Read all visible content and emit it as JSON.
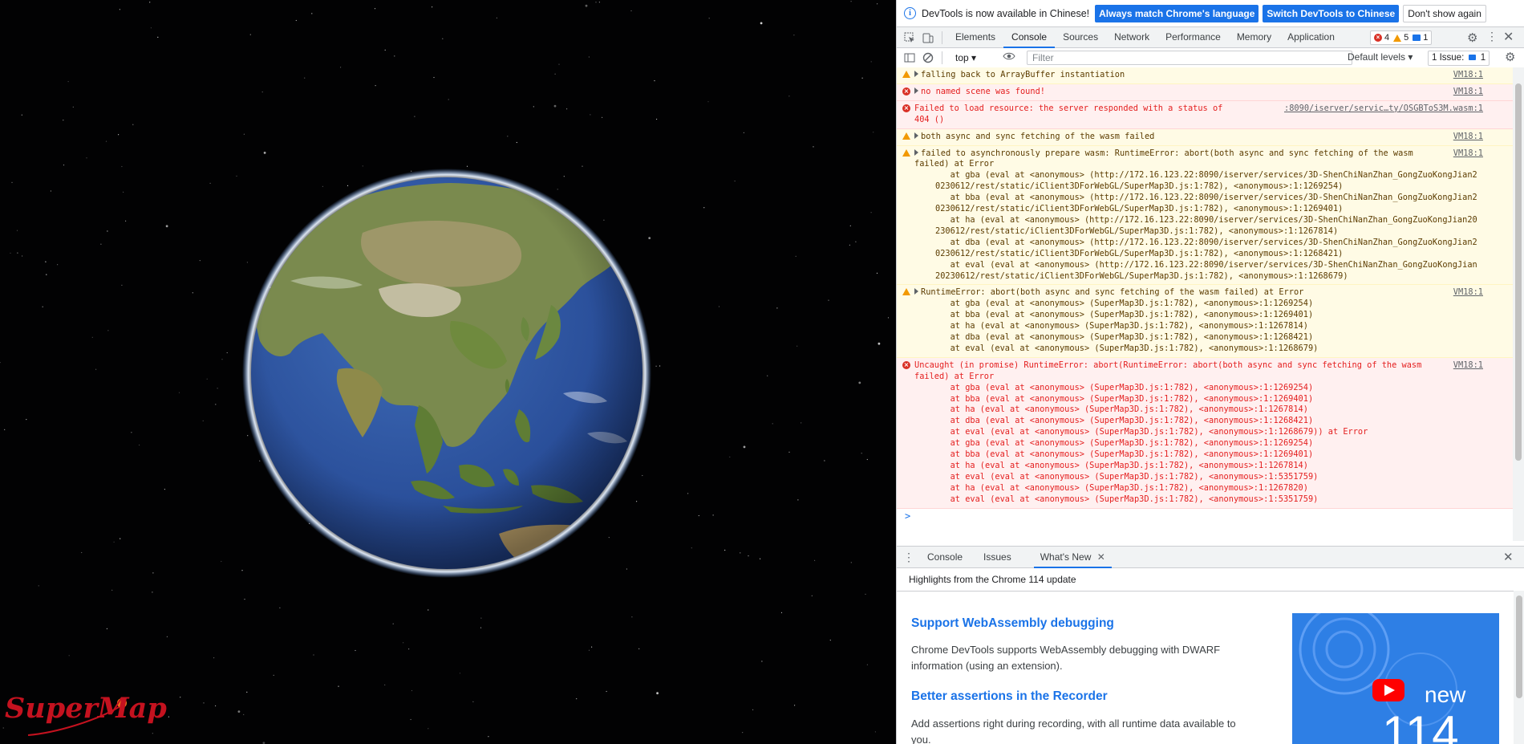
{
  "viewport": {
    "logo_text": "SuperMap",
    "colors": {
      "background": "#020203",
      "logo": "#c4121f",
      "ocean": "#2a4f9a",
      "land": "#7a8a4e"
    }
  },
  "devtools": {
    "infobar": {
      "text": "DevTools is now available in Chinese!",
      "btn_match": "Always match Chrome's language",
      "btn_switch": "Switch DevTools to Chinese",
      "btn_dont": "Don't show again"
    },
    "tabs": [
      "Elements",
      "Console",
      "Sources",
      "Network",
      "Performance",
      "Memory",
      "Application"
    ],
    "active_tab": "Console",
    "counts": {
      "errors": "4",
      "warnings": "5",
      "messages": "1"
    },
    "toolbar": {
      "context": "top",
      "filter_placeholder": "Filter",
      "levels": "Default levels",
      "issues_label": "1 Issue:",
      "issues_count": "1"
    },
    "console": {
      "rows": [
        {
          "level": "warn",
          "expandable": true,
          "text": "falling back to ArrayBuffer instantiation",
          "source": "VM18:1"
        },
        {
          "level": "error",
          "expandable": true,
          "text": "no named scene was found!",
          "source": "VM18:1"
        },
        {
          "level": "error",
          "expandable": false,
          "text": "Failed to load resource: the server responded with a status of\n404 ()",
          "source": ":8090/iserver/servic…ty/OSGBToS3M.wasm:1"
        },
        {
          "level": "warn",
          "expandable": true,
          "text": "both async and sync fetching of the wasm failed",
          "source": "VM18:1"
        },
        {
          "level": "warn",
          "expandable": true,
          "text": "failed to asynchronously prepare wasm: RuntimeError: abort(both async and sync fetching of the wasm\nfailed) at Error",
          "source": "VM18:1",
          "frames": [
            "   at gba (eval at <anonymous> (http://172.16.123.22:8090/iserver/services/3D-ShenChiNanZhan_GongZuoKongJian2\n0230612/rest/static/iClient3DForWebGL/SuperMap3D.js:1:782), <anonymous>:1:1269254)",
            "   at bba (eval at <anonymous> (http://172.16.123.22:8090/iserver/services/3D-ShenChiNanZhan_GongZuoKongJian2\n0230612/rest/static/iClient3DForWebGL/SuperMap3D.js:1:782), <anonymous>:1:1269401)",
            "   at ha (eval at <anonymous> (http://172.16.123.22:8090/iserver/services/3D-ShenChiNanZhan_GongZuoKongJian20\n230612/rest/static/iClient3DForWebGL/SuperMap3D.js:1:782), <anonymous>:1:1267814)",
            "   at dba (eval at <anonymous> (http://172.16.123.22:8090/iserver/services/3D-ShenChiNanZhan_GongZuoKongJian2\n0230612/rest/static/iClient3DForWebGL/SuperMap3D.js:1:782), <anonymous>:1:1268421)",
            "   at eval (eval at <anonymous> (http://172.16.123.22:8090/iserver/services/3D-ShenChiNanZhan_GongZuoKongJian\n20230612/rest/static/iClient3DForWebGL/SuperMap3D.js:1:782), <anonymous>:1:1268679)"
          ]
        },
        {
          "level": "warn",
          "expandable": true,
          "text": "RuntimeError: abort(both async and sync fetching of the wasm failed) at Error",
          "source": "VM18:1",
          "frames": [
            "   at gba (eval at <anonymous> (SuperMap3D.js:1:782), <anonymous>:1:1269254)",
            "   at bba (eval at <anonymous> (SuperMap3D.js:1:782), <anonymous>:1:1269401)",
            "   at ha (eval at <anonymous> (SuperMap3D.js:1:782), <anonymous>:1:1267814)",
            "   at dba (eval at <anonymous> (SuperMap3D.js:1:782), <anonymous>:1:1268421)",
            "   at eval (eval at <anonymous> (SuperMap3D.js:1:782), <anonymous>:1:1268679)"
          ]
        },
        {
          "level": "error",
          "expandable": false,
          "text": "Uncaught (in promise) RuntimeError: abort(RuntimeError: abort(both async and sync fetching of the wasm\nfailed) at Error",
          "source": "VM18:1",
          "frames": [
            "   at gba (eval at <anonymous> (SuperMap3D.js:1:782), <anonymous>:1:1269254)",
            "   at bba (eval at <anonymous> (SuperMap3D.js:1:782), <anonymous>:1:1269401)",
            "   at ha (eval at <anonymous> (SuperMap3D.js:1:782), <anonymous>:1:1267814)",
            "   at dba (eval at <anonymous> (SuperMap3D.js:1:782), <anonymous>:1:1268421)",
            "   at eval (eval at <anonymous> (SuperMap3D.js:1:782), <anonymous>:1:1268679)) at Error",
            "   at gba (eval at <anonymous> (SuperMap3D.js:1:782), <anonymous>:1:1269254)",
            "   at bba (eval at <anonymous> (SuperMap3D.js:1:782), <anonymous>:1:1269401)",
            "   at ha (eval at <anonymous> (SuperMap3D.js:1:782), <anonymous>:1:1267814)",
            "   at eval (eval at <anonymous> (SuperMap3D.js:1:782), <anonymous>:1:5351759)",
            "   at ha (eval at <anonymous> (SuperMap3D.js:1:782), <anonymous>:1:1267820)",
            "   at eval (eval at <anonymous> (SuperMap3D.js:1:782), <anonymous>:1:5351759)"
          ]
        }
      ],
      "prompt": ">"
    },
    "drawer": {
      "tabs": [
        "Console",
        "Issues",
        "What's New"
      ],
      "active_tab": "What's New",
      "highlights": "Highlights from the Chrome 114 update",
      "items": [
        {
          "title": "Support WebAssembly debugging",
          "text": "Chrome DevTools supports WebAssembly debugging with DWARF information (using an extension)."
        },
        {
          "title": "Better assertions in the Recorder",
          "text": "Add assertions right during recording, with all runtime data available to you."
        }
      ],
      "thumb": {
        "word": "new",
        "version": "114"
      }
    }
  }
}
